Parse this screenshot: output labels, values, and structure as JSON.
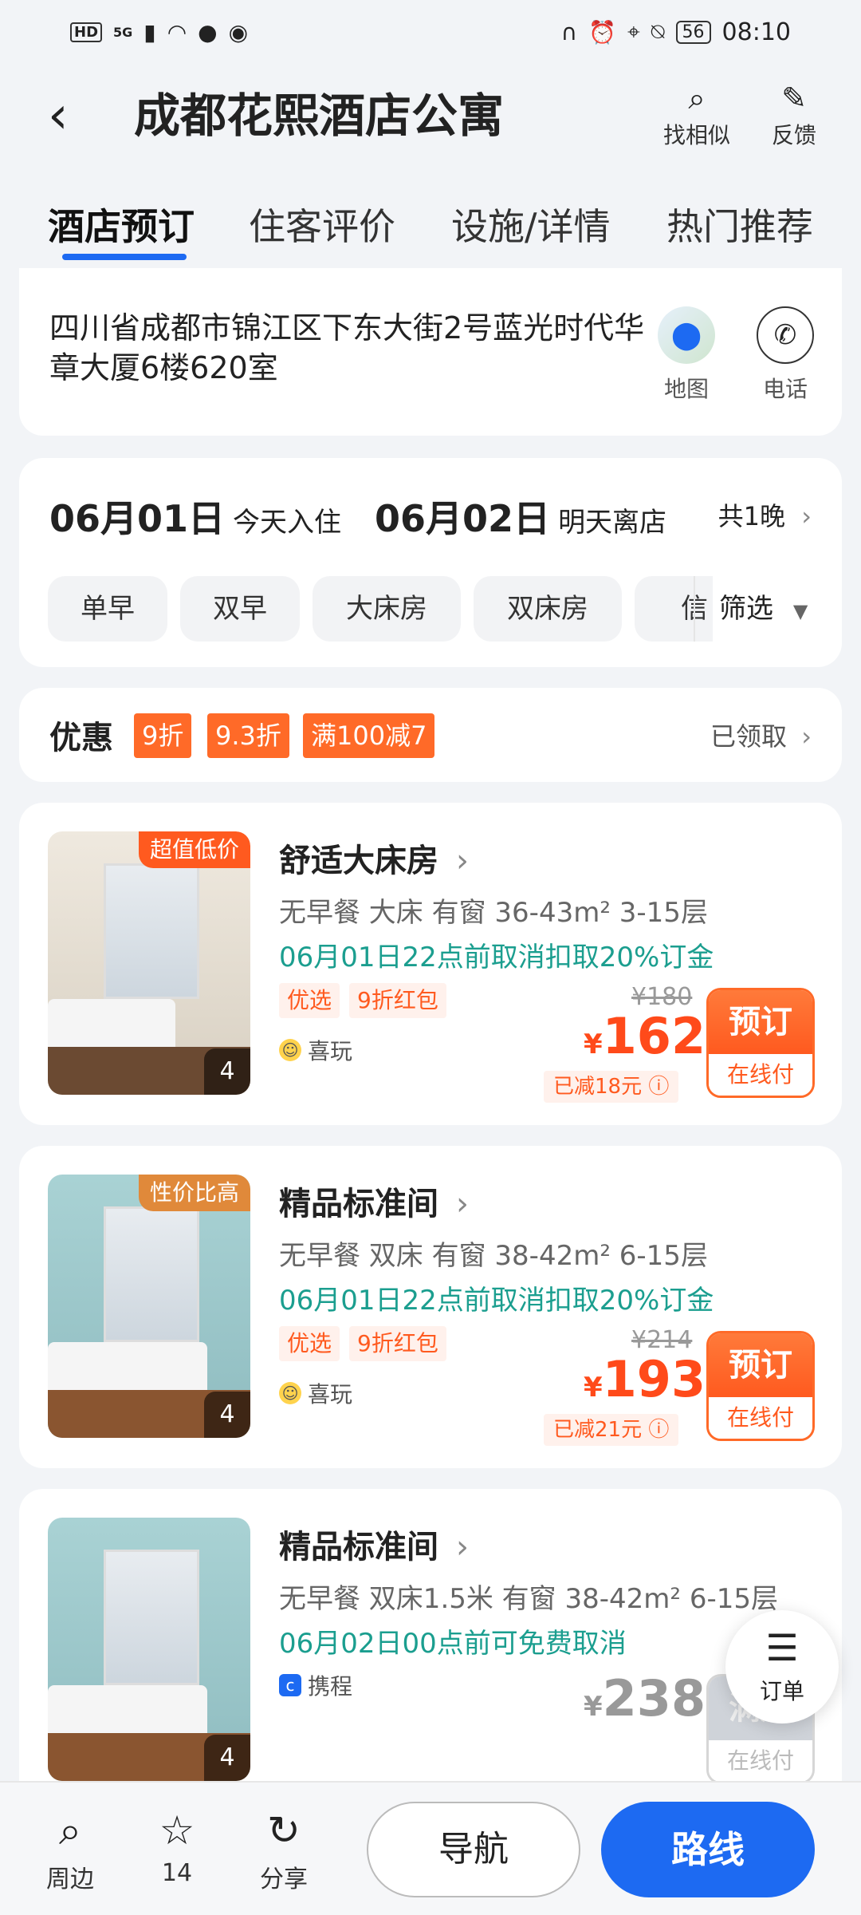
{
  "status_bar": {
    "hd": "HD",
    "net": "5G",
    "battery": "56",
    "time": "08:10"
  },
  "header": {
    "title": "成都花熙酒店公寓",
    "find_similar": "找相似",
    "feedback": "反馈"
  },
  "tabs": [
    "酒店预订",
    "住客评价",
    "设施/详情",
    "热门推荐"
  ],
  "address": {
    "text": "四川省成都市锦江区下东大街2号蓝光时代华章大厦6楼620室",
    "map_label": "地图",
    "phone_label": "电话"
  },
  "stay": {
    "checkin_date": "06月01日",
    "checkin_label": "今天入住",
    "checkout_date": "06月02日",
    "checkout_label": "明天离店",
    "nights": "共1晚"
  },
  "chips": [
    "单早",
    "双早",
    "大床房",
    "双床房",
    "信"
  ],
  "filter_label": "筛选",
  "promo": {
    "title": "优惠",
    "tags": [
      "9折",
      "9.3折",
      "满100减7"
    ],
    "claimed": "已领取"
  },
  "rooms": [
    {
      "badge": "超值低价",
      "badge_color": "#ff5a1f",
      "photo_count": "4",
      "name": "舒适大床房",
      "spec": "无早餐  大床  有窗  36-43m²  3-15层",
      "cancel": "06月01日22点前取消扣取20%订金",
      "tags": [
        "优选",
        "9折红包"
      ],
      "source": "喜玩",
      "original_price": "¥180",
      "currency": "¥",
      "price": "162",
      "saved": "已减18元 ⓘ",
      "book_label": "预订",
      "pay_label": "在线付"
    },
    {
      "badge": "性价比高",
      "badge_color": "#e0893a",
      "photo_count": "4",
      "name": "精品标准间",
      "spec": "无早餐  双床  有窗  38-42m²  6-15层",
      "cancel": "06月01日22点前取消扣取20%订金",
      "tags": [
        "优选",
        "9折红包"
      ],
      "source": "喜玩",
      "original_price": "¥214",
      "currency": "¥",
      "price": "193",
      "saved": "已减21元 ⓘ",
      "book_label": "预订",
      "pay_label": "在线付"
    },
    {
      "photo_count": "4",
      "name": "精品标准间",
      "spec": "无早餐  双床1.5米  有窗  38-42m²  6-15层",
      "cancel": "06月02日00点前可免费取消",
      "source": "携程",
      "currency": "¥",
      "price": "238",
      "book_label": "满房",
      "pay_label": "在线付"
    }
  ],
  "float_order": {
    "label": "订单"
  },
  "bottom_bar": {
    "nearby": "周边",
    "favorites": "14",
    "share": "分享",
    "navigate": "导航",
    "route": "路线"
  },
  "colors": {
    "accent": "#1d6af2",
    "price": "#ff4a1a",
    "cancel": "#1b9e8f",
    "tag": "#ff6a28"
  }
}
